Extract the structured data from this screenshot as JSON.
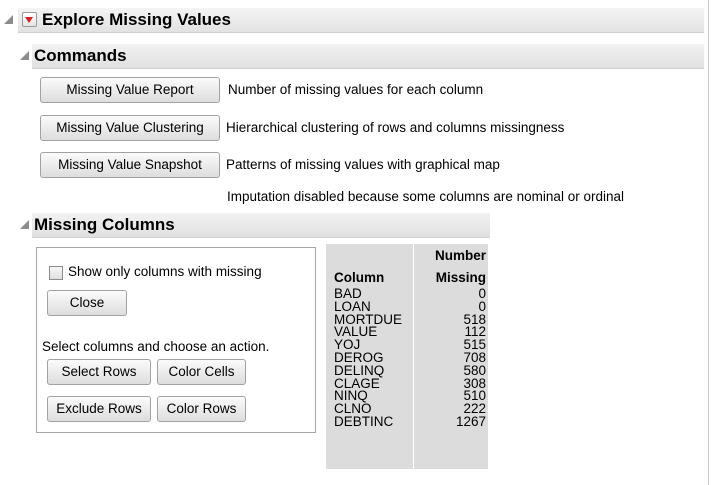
{
  "report": {
    "title": "Explore Missing Values"
  },
  "commands": {
    "title": "Commands",
    "items": [
      {
        "button": "Missing Value Report",
        "description": "Number of missing values for each column"
      },
      {
        "button": "Missing Value Clustering",
        "description": "Hierarchical clustering of rows and columns missingness"
      },
      {
        "button": "Missing Value Snapshot",
        "description": "Patterns of missing values with graphical map"
      }
    ],
    "note": "Imputation disabled because some columns are nominal or ordinal"
  },
  "missing_columns": {
    "title": "Missing Columns",
    "checkbox_label": "Show only columns with missing",
    "checkbox_checked": false,
    "close_label": "Close",
    "instruction": "Select columns and choose an action.",
    "actions": {
      "select_rows": "Select Rows",
      "color_cells": "Color Cells",
      "exclude_rows": "Exclude Rows",
      "color_rows": "Color Rows"
    },
    "table": {
      "col_header": "Column",
      "num_header_line1": "Number",
      "num_header_line2": "Missing",
      "rows": [
        {
          "column": "BAD",
          "missing": "0"
        },
        {
          "column": "LOAN",
          "missing": "0"
        },
        {
          "column": "MORTDUE",
          "missing": "518"
        },
        {
          "column": "VALUE",
          "missing": "112"
        },
        {
          "column": "YOJ",
          "missing": "515"
        },
        {
          "column": "DEROG",
          "missing": "708"
        },
        {
          "column": "DELINQ",
          "missing": "580"
        },
        {
          "column": "CLAGE",
          "missing": "308"
        },
        {
          "column": "NINQ",
          "missing": "510"
        },
        {
          "column": "CLNO",
          "missing": "222"
        },
        {
          "column": "DEBTINC",
          "missing": "1267"
        }
      ]
    }
  }
}
